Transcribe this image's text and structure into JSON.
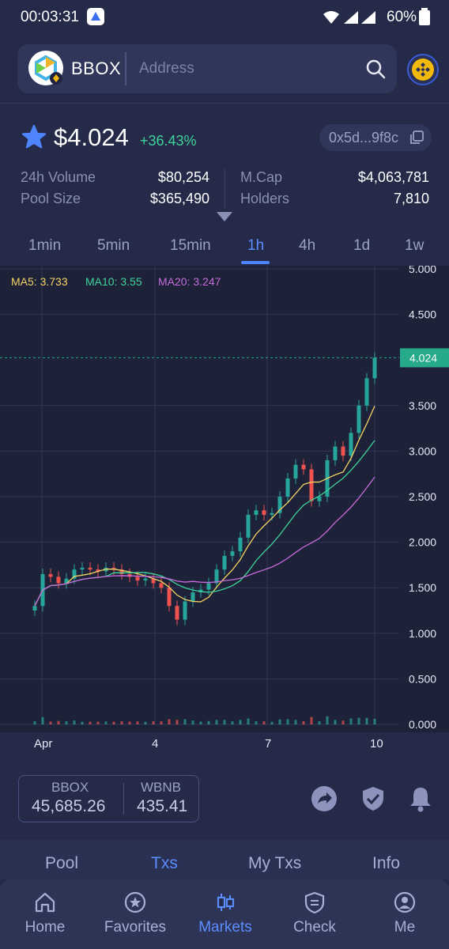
{
  "status_bar": {
    "time": "00:03:31",
    "battery": "60%"
  },
  "header": {
    "token_name": "BBOX",
    "search_placeholder": "Address"
  },
  "price_info": {
    "price": "$4.024",
    "change": "+36.43%",
    "contract": "0x5d...9f8c",
    "stats": {
      "volume_label": "24h Volume",
      "volume": "$80,254",
      "pool_label": "Pool Size",
      "pool": "$365,490",
      "mcap_label": "M.Cap",
      "mcap": "$4,063,781",
      "holders_label": "Holders",
      "holders": "7,810"
    }
  },
  "timeframes": [
    "1min",
    "5min",
    "15min",
    "1h",
    "4h",
    "1d",
    "1w"
  ],
  "active_timeframe": "1h",
  "chart_data": {
    "type": "candlestick",
    "ma_labels": {
      "ma5": "MA5: 3.733",
      "ma10": "MA10: 3.55",
      "ma20": "MA20: 3.247"
    },
    "current_price_tag": "4.024",
    "y_ticks": [
      "5.000",
      "4.500",
      "3.500",
      "3.000",
      "2.500",
      "2.000",
      "1.500",
      "1.000",
      "0.500",
      "0.000"
    ],
    "x_labels": [
      "Apr",
      "4",
      "7",
      "10"
    ],
    "ylim": [
      0,
      5
    ],
    "current_price": 4.024,
    "close_series": [
      1.3,
      1.65,
      1.62,
      1.55,
      1.6,
      1.7,
      1.72,
      1.7,
      1.68,
      1.72,
      1.7,
      1.65,
      1.62,
      1.58,
      1.6,
      1.55,
      1.5,
      1.3,
      1.15,
      1.35,
      1.45,
      1.48,
      1.55,
      1.7,
      1.85,
      1.9,
      2.05,
      2.3,
      2.35,
      2.3,
      2.32,
      2.5,
      2.7,
      2.85,
      2.8,
      2.45,
      2.5,
      2.9,
      3.05,
      2.95,
      3.2,
      3.5,
      3.8,
      4.024
    ],
    "colors": {
      "up": "#26a69a",
      "down": "#ef5350",
      "ma5": "#f6d365",
      "ma10": "#3ed39b",
      "ma20": "#c86bdc",
      "price_tag": "#27a98c"
    }
  },
  "swap": {
    "token_a": "BBOX",
    "amount_a": "45,685.26",
    "token_b": "WBNB",
    "amount_b": "435.41"
  },
  "icons": {
    "share": "share-arrow-icon",
    "shield": "shield-check-icon",
    "bell": "bell-icon"
  },
  "sub_tabs": [
    "Pool",
    "Txs",
    "My Txs",
    "Info"
  ],
  "active_sub_tab": "Txs",
  "nav": [
    {
      "label": "Home"
    },
    {
      "label": "Favorites"
    },
    {
      "label": "Markets"
    },
    {
      "label": "Check"
    },
    {
      "label": "Me"
    }
  ]
}
